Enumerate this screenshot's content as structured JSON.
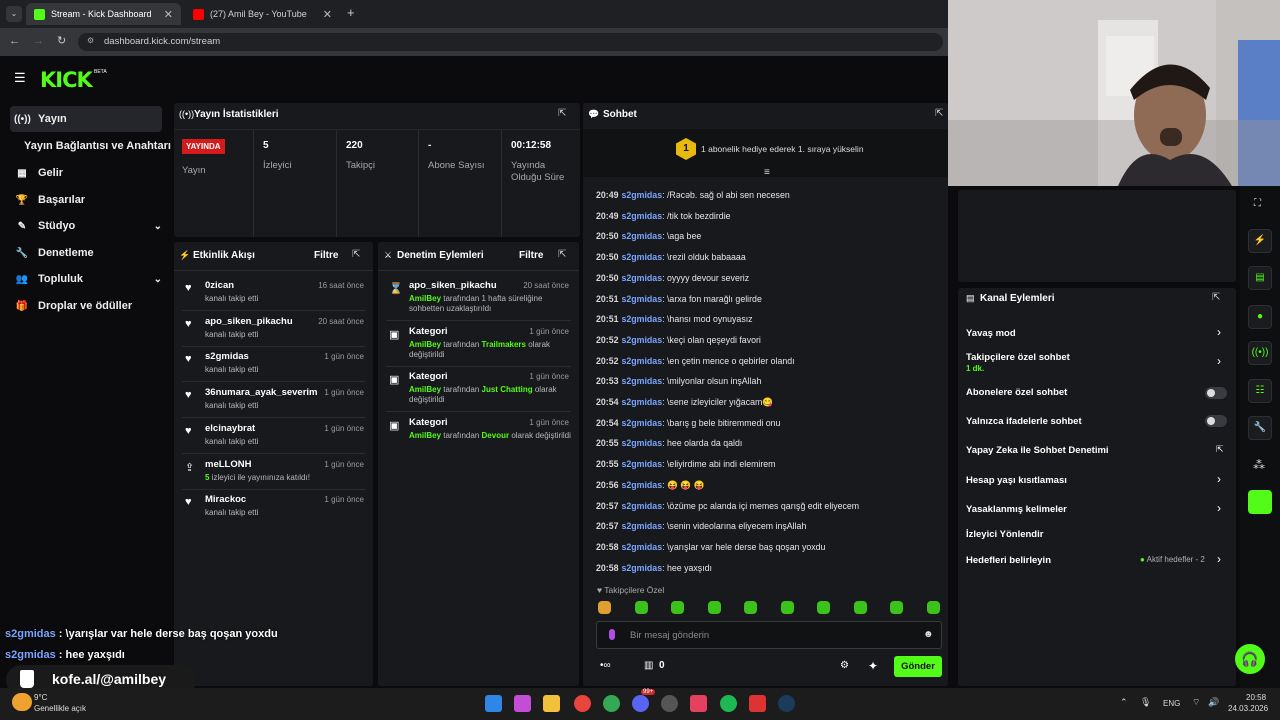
{
  "browser": {
    "tabs": [
      {
        "title": "Stream - Kick Dashboard",
        "favicon_color": "#53fc18"
      },
      {
        "title": "(27) Amil Bey - YouTube",
        "favicon_color": "#ff0000"
      }
    ],
    "url": "dashboard.kick.com/stream"
  },
  "brand": {
    "logo": "KICK",
    "badge": "BETA",
    "accent": "#53fc18"
  },
  "sidebar": {
    "items": [
      {
        "label": "Yayın",
        "icon": "broadcast-icon"
      },
      {
        "label": "Yayın Bağlantısı ve Anahtarı"
      },
      {
        "label": "Gelir",
        "icon": "chart-icon"
      },
      {
        "label": "Başarılar",
        "icon": "trophy-icon"
      },
      {
        "label": "Stüdyo",
        "icon": "brush-icon"
      },
      {
        "label": "Denetleme",
        "icon": "wrench-icon"
      },
      {
        "label": "Topluluk",
        "icon": "people-icon"
      },
      {
        "label": "Droplar ve ödüller",
        "icon": "gift-icon"
      }
    ]
  },
  "stats": {
    "title": "Yayın İstatistikleri",
    "live_badge": "YAYINDA",
    "live_label": "Yayın",
    "viewers": "5",
    "viewers_label": "İzleyici",
    "followers": "220",
    "followers_label": "Takipçi",
    "subs": "-",
    "subs_label": "Abone Sayısı",
    "duration": "00:12:58",
    "duration_label": "Yayında Olduğu Süre"
  },
  "activity": {
    "title": "Etkinlik Akışı",
    "filter": "Filtre",
    "items": [
      {
        "name": "0zican",
        "sub": "kanalı takip etti",
        "time": "16 saat önce"
      },
      {
        "name": "apo_siken_pikachu",
        "sub": "kanalı takip etti",
        "time": "20 saat önce"
      },
      {
        "name": "s2gmidas",
        "sub": "kanalı takip etti",
        "time": "1 gün önce"
      },
      {
        "name": "36numara_ayak_severim",
        "sub": "kanalı takip etti",
        "time": "1 gün önce"
      },
      {
        "name": "elcinaybrat",
        "sub": "kanalı takip etti",
        "time": "1 gün önce"
      },
      {
        "name": "meLLONH",
        "sub_count": "5",
        "sub": "izleyici ile yayınınıza katıldı!",
        "time": "1 gün önce"
      },
      {
        "name": "Mirackoc",
        "sub": "kanalı takip etti",
        "time": "1 gün önce"
      }
    ]
  },
  "mod": {
    "title": "Denetim Eylemleri",
    "filter": "Filtre",
    "items": [
      {
        "title": "apo_siken_pikachu",
        "time": "20 saat önce",
        "actor": "AmilBey",
        "text": "tarafından 1 hafta süreliğine sohbetten uzaklaştırıldı"
      },
      {
        "title": "Kategori",
        "time": "1 gün önce",
        "actor": "AmilBey",
        "pre": "tarafından",
        "game": "Trailmakers",
        "post": "olarak değiştirildi"
      },
      {
        "title": "Kategori",
        "time": "1 gün önce",
        "actor": "AmilBey",
        "pre": "tarafından",
        "game": "Just Chatting",
        "post": "olarak değiştirildi"
      },
      {
        "title": "Kategori",
        "time": "1 gün önce",
        "actor": "AmilBey",
        "pre": "tarafından",
        "game": "Devour",
        "post": "olarak değiştirildi"
      }
    ]
  },
  "chat": {
    "title": "Sohbet",
    "pinned_rank": "1",
    "pinned": "1 abonelik hediye ederek 1. sıraya yükselin",
    "messages": [
      {
        "t": "20:49",
        "u": "s2gmidas",
        "m": ": /Rəcəb. sağ ol abi sen necesen"
      },
      {
        "t": "20:49",
        "u": "s2gmidas",
        "m": ": /tik tok bezdirdie"
      },
      {
        "t": "20:50",
        "u": "s2gmidas",
        "m": ": \\aga bee"
      },
      {
        "t": "20:50",
        "u": "s2gmidas",
        "m": ": \\rezil olduk babaaaa"
      },
      {
        "t": "20:50",
        "u": "s2gmidas",
        "m": ": oyyyy devour severiz"
      },
      {
        "t": "20:51",
        "u": "s2gmidas",
        "m": ": \\arxa fon marağlı gelirde"
      },
      {
        "t": "20:51",
        "u": "s2gmidas",
        "m": ": \\hansı mod oynuyasız"
      },
      {
        "t": "20:52",
        "u": "s2gmidas",
        "m": ": \\keçi olan qeşeydi favori"
      },
      {
        "t": "20:52",
        "u": "s2gmidas",
        "m": ": \\en çetin mence o qebirler olandı"
      },
      {
        "t": "20:53",
        "u": "s2gmidas",
        "m": ": \\milyonlar olsun inşAllah"
      },
      {
        "t": "20:54",
        "u": "s2gmidas",
        "m": ": \\sene izleyiciler yığacam😋"
      },
      {
        "t": "20:54",
        "u": "s2gmidas",
        "m": ": \\barış g bele bitiremmedi onu"
      },
      {
        "t": "20:55",
        "u": "s2gmidas",
        "m": ": hee olarda da qaldı"
      },
      {
        "t": "20:55",
        "u": "s2gmidas",
        "m": ": \\eliyirdime abi indi elemirem"
      },
      {
        "t": "20:56",
        "u": "s2gmidas",
        "m": ": 😝 😝 😝"
      },
      {
        "t": "20:57",
        "u": "s2gmidas",
        "m": ": \\özüme pc alanda içi memes qarışğ edit eliyecem"
      },
      {
        "t": "20:57",
        "u": "s2gmidas",
        "m": ": \\senin videolarına eliyecem inşAllah"
      },
      {
        "t": "20:58",
        "u": "s2gmidas",
        "m": ": \\yarışlar var hele derse baş qoşan yoxdu"
      },
      {
        "t": "20:58",
        "u": "s2gmidas",
        "m": ": hee yaxşıdı"
      }
    ],
    "followers_only": "Takipçilere Özel",
    "placeholder": "Bir mesaj gönderin",
    "points": "0",
    "send": "Gönder"
  },
  "actions": {
    "title": "Kanal Eylemleri",
    "slow": "Yavaş mod",
    "followers": "Takipçilere özel sohbet",
    "followers_sub": "1 dk.",
    "subs": "Abonelere özel sohbet",
    "emotes": "Yalnızca ifadelerle sohbet",
    "ai": "Yapay Zeka ile Sohbet Denetimi",
    "age": "Hesap yaşı kısıtlaması",
    "banned": "Yasaklanmış kelimeler",
    "redirect": "İzleyici Yönlendir",
    "goals": "Hedefleri belirleyin",
    "goals_badge": "Aktif hedefler - 2"
  },
  "overlay": {
    "lines": [
      {
        "u": "s2gmidas",
        "m": " : \\yarışlar var hele derse baş qoşan yoxdu"
      },
      {
        "u": "s2gmidas",
        "m": " : hee yaxşıdı"
      }
    ],
    "coffee": "kofe.al/@amilbey"
  },
  "taskbar": {
    "weather_temp": "9°C",
    "weather_desc": "Genellikle açık",
    "lang": "ENG",
    "time": "20:58",
    "date": "24.03.2026",
    "badge": "99+"
  }
}
